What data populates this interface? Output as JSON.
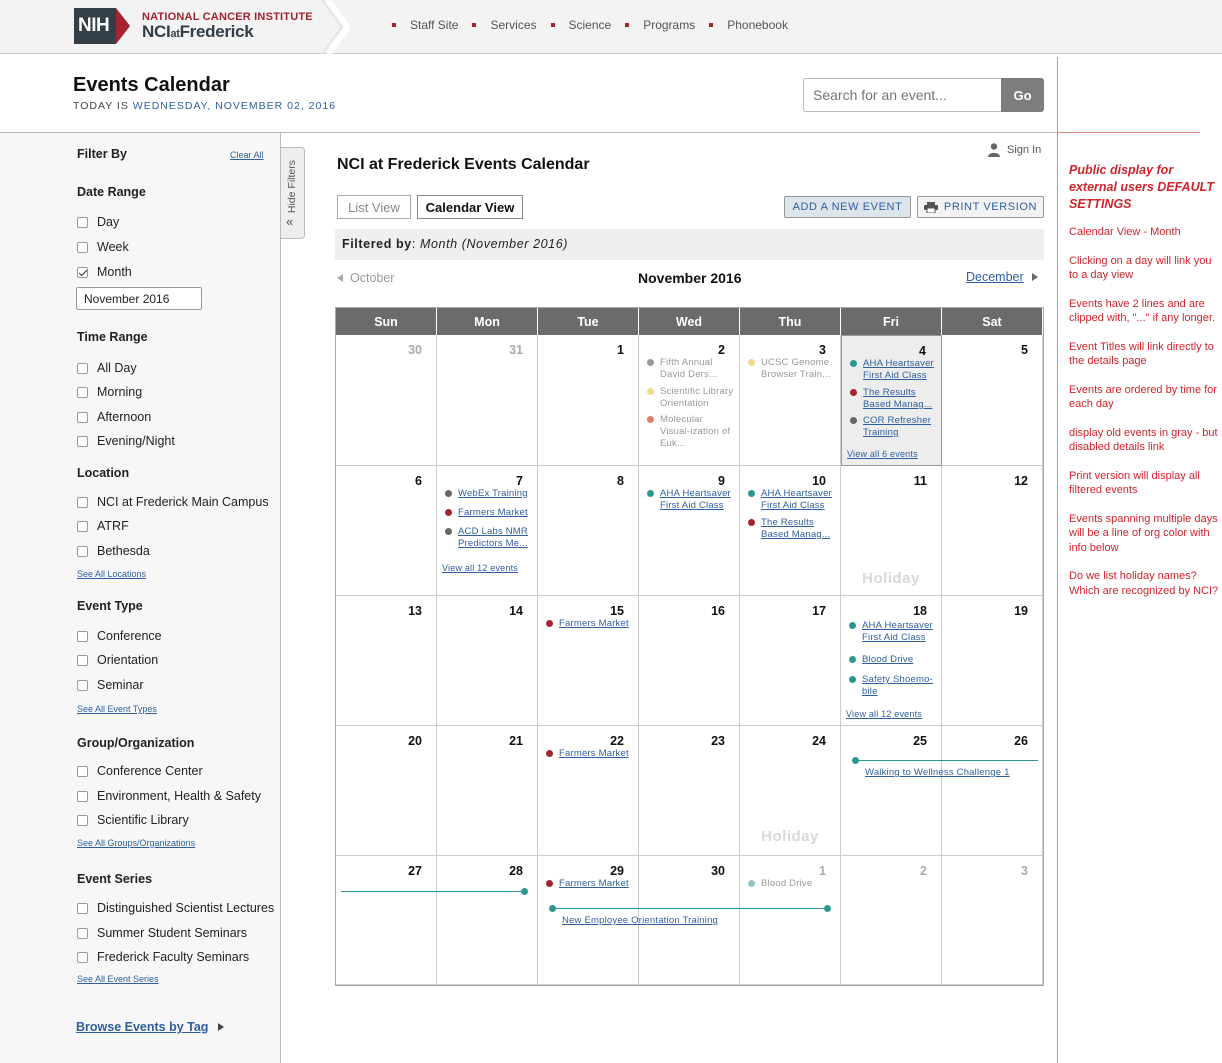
{
  "logo": {
    "mark": "NIH",
    "line1": "NATIONAL CANCER INSTITUTE",
    "line2_a": "NCI",
    "line2_b": "at",
    "line2_c": "Frederick"
  },
  "topnav": [
    "Staff Site",
    "Services",
    "Science",
    "Programs",
    "Phonebook"
  ],
  "page": {
    "title": "Events Calendar",
    "today_prefix": "TODAY IS",
    "today_date": "WEDNESDAY, NOVEMBER 02, 2016"
  },
  "search": {
    "placeholder": "Search for an event...",
    "go": "Go"
  },
  "sidebar": {
    "filter_by": "Filter By",
    "clear_all": "Clear All",
    "date_range": {
      "heading": "Date Range",
      "options": [
        "Day",
        "Week",
        "Month"
      ],
      "checked": "Month",
      "month_value": "November 2016"
    },
    "time_range": {
      "heading": "Time Range",
      "options": [
        "All Day",
        "Morning",
        "Afternoon",
        "Evening/Night"
      ]
    },
    "location": {
      "heading": "Location",
      "options": [
        "NCI at Frederick Main Campus",
        "ATRF",
        "Bethesda"
      ],
      "link": "See All Locations"
    },
    "event_type": {
      "heading": "Event Type",
      "options": [
        "Conference",
        "Orientation",
        "Seminar"
      ],
      "link": "See All Event Types"
    },
    "group": {
      "heading": "Group/Organization",
      "options": [
        "Conference Center",
        "Environment, Health & Safety",
        "Scientific Library"
      ],
      "link": "See All Groups/Organizations"
    },
    "series": {
      "heading": "Event Series",
      "options": [
        "Distinguished Scientist Lectures",
        "Summer Student Seminars",
        "Frederick Faculty Seminars"
      ],
      "link": "See All Event Series"
    },
    "browse": "Browse Events by Tag",
    "hide_filters": "Hide Filters"
  },
  "main": {
    "title": "NCI at Frederick Events Calendar",
    "sign_in": "Sign In",
    "list_view": "List View",
    "calendar_view": "Calendar View",
    "add_event": "ADD A NEW EVENT",
    "print_version": "PRINT VERSION",
    "filtered_label": "Filtered by",
    "filtered_value": "Month (November 2016)",
    "prev_month": "October",
    "current_month": "November 2016",
    "next_month": "December"
  },
  "colors": {
    "teal": "#2a9890",
    "red": "#a3232f",
    "gray": "#666666",
    "yellow": "#f0d890",
    "salmon": "#e07b6e",
    "lightteal": "#8fc6c2"
  },
  "calendar": {
    "days_of_week": [
      "Sun",
      "Mon",
      "Tue",
      "Wed",
      "Thu",
      "Fri",
      "Sat"
    ],
    "weeks": [
      [
        {
          "n": "30",
          "other": true
        },
        {
          "n": "31",
          "other": true
        },
        {
          "n": "1"
        },
        {
          "n": "2",
          "events": [
            {
              "t": "Fifth Annual David Ders...",
              "c": "#9a9a9a",
              "past": true
            },
            {
              "t": "Scientific Library Orientation",
              "c": "#f0d890",
              "past": true
            },
            {
              "t": "Molecular Visual-ization of Euk...",
              "c": "#e07b6e",
              "past": true
            }
          ]
        },
        {
          "n": "3",
          "events": [
            {
              "t": "UCSC Genome Browser Train...",
              "c": "#f0d890",
              "past": true
            }
          ]
        },
        {
          "n": "4",
          "today": true,
          "events": [
            {
              "t": "AHA Heartsaver First Aid Class",
              "c": "#2a9890"
            },
            {
              "t": "The Results Based Manag...",
              "c": "#a3232f"
            },
            {
              "t": "COR Refresher Training",
              "c": "#666666"
            }
          ],
          "viewall": "View all 6 events"
        },
        {
          "n": "5"
        }
      ],
      [
        {
          "n": "6"
        },
        {
          "n": "7",
          "events": [
            {
              "t": "WebEx Training",
              "c": "#666666"
            },
            {
              "t": "Farmers Market",
              "c": "#a3232f"
            },
            {
              "t": "ACD Labs NMR Predictors Me...",
              "c": "#666666"
            }
          ],
          "viewall": "View all 12 events"
        },
        {
          "n": "8"
        },
        {
          "n": "9",
          "events": [
            {
              "t": "AHA Heartsaver First Aid Class",
              "c": "#2a9890"
            }
          ]
        },
        {
          "n": "10",
          "events": [
            {
              "t": "AHA Heartsaver First Aid Class",
              "c": "#2a9890"
            },
            {
              "t": "The Results Based Manag...",
              "c": "#a3232f"
            }
          ]
        },
        {
          "n": "11",
          "holiday": "Holiday"
        },
        {
          "n": "12"
        }
      ],
      [
        {
          "n": "13"
        },
        {
          "n": "14"
        },
        {
          "n": "15",
          "events": [
            {
              "t": "Farmers Market",
              "c": "#a3232f"
            }
          ]
        },
        {
          "n": "16"
        },
        {
          "n": "17"
        },
        {
          "n": "18",
          "events": [
            {
              "t": "AHA Heartsaver First Aid Class",
              "c": "#2a9890"
            },
            {
              "t": "Blood Drive",
              "c": "#2a9890"
            },
            {
              "t": "Safety Shoemo-bile",
              "c": "#2a9890"
            }
          ],
          "viewall": "View all 12 events"
        },
        {
          "n": "19"
        }
      ],
      [
        {
          "n": "20"
        },
        {
          "n": "21"
        },
        {
          "n": "22",
          "events": [
            {
              "t": "Farmers Market",
              "c": "#a3232f"
            }
          ]
        },
        {
          "n": "23"
        },
        {
          "n": "24",
          "holiday": "Holiday"
        },
        {
          "n": "25"
        },
        {
          "n": "26"
        }
      ],
      [
        {
          "n": "27"
        },
        {
          "n": "28"
        },
        {
          "n": "29",
          "events": [
            {
              "t": "Farmers Market",
              "c": "#a3232f"
            }
          ]
        },
        {
          "n": "30"
        },
        {
          "n": "1",
          "other": true,
          "events": [
            {
              "t": "Blood Drive",
              "c": "#8fc6c2",
              "past": true
            }
          ]
        },
        {
          "n": "2",
          "other": true
        },
        {
          "n": "3",
          "other": true
        }
      ]
    ],
    "spans": [
      {
        "label": "Walking to Wellness Challenge 1",
        "week": 3,
        "start_col": 5,
        "end_col": 6,
        "start_dot": true,
        "end_dot": false
      },
      {
        "label": "",
        "week": 4,
        "start_col": 0,
        "end_col": 1,
        "start_dot": false,
        "end_dot": true
      },
      {
        "label": "New Employee Orientation Training",
        "week": 4,
        "start_col": 2,
        "end_col": 4,
        "start_dot": true,
        "end_dot": true
      }
    ]
  },
  "notes": {
    "head": "Public display for external users DEFAULT SETTINGS",
    "items": [
      "Calendar View - Month",
      "Clicking on a day will link you to a day view",
      "Events have 2 lines and are clipped with, \"...\" if any longer.",
      "Event Titles will link directly to the details page",
      "Events are ordered by time for each day",
      "display old events in gray - but disabled details link",
      "Print version will display all filtered events",
      "Events spanning multiple days will be a line of org color with info below",
      "Do we list holiday names? Which are recognized by NCI?"
    ]
  }
}
